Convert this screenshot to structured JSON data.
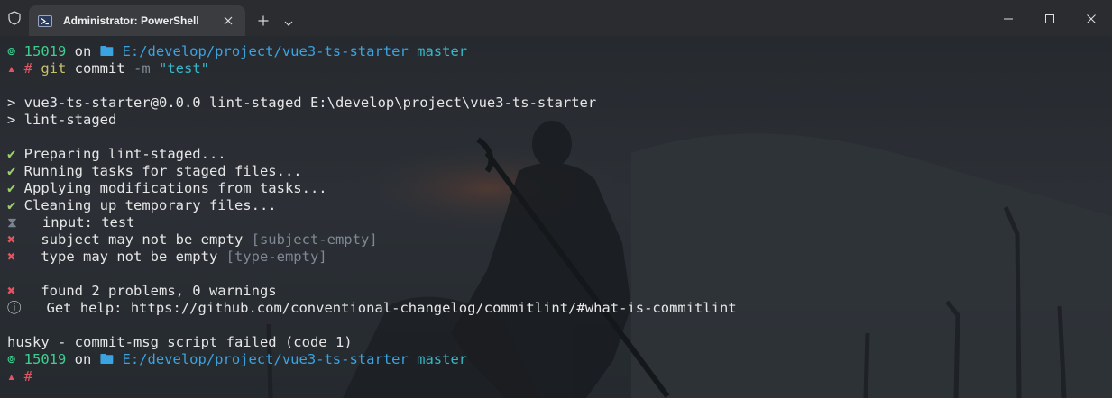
{
  "window": {
    "tab_title": "Administrator: PowerShell"
  },
  "icons": {
    "shield": "shield-icon",
    "terminal": "powershell-icon",
    "close": "close-icon",
    "new_tab": "plus-icon",
    "dropdown": "chevron-down-icon",
    "minimize": "minimize-icon",
    "maximize": "maximize-icon",
    "window_close": "close-icon"
  },
  "colors": {
    "prompt_green": "#3ecf8e",
    "path_blue": "#3ba3e0",
    "branch_cyan": "#37b8c9",
    "error_red": "#e05561",
    "check_green": "#9ecf6a"
  },
  "terminal": {
    "prompt1": {
      "symbol": "⊚ ",
      "pid": "15019",
      "on": " on ",
      "folder": "🖿 ",
      "path": "E:/develop/project/vue3-ts-starter",
      "branch_icon": " ",
      "branch": "master"
    },
    "command_line": {
      "arrow": "▴ ",
      "hash": "#",
      "git": " git",
      "commit": " commit",
      "flag": " -m",
      "arg": " \"test\""
    },
    "npm_line1": "> vue3-ts-starter@0.0.0 lint-staged E:\\develop\\project\\vue3-ts-starter",
    "npm_line2": "> lint-staged",
    "tasks": [
      {
        "icon": "✔",
        "text": " Preparing lint-staged..."
      },
      {
        "icon": "✔",
        "text": " Running tasks for staged files..."
      },
      {
        "icon": "✔",
        "text": " Applying modifications from tasks..."
      },
      {
        "icon": "✔",
        "text": " Cleaning up temporary files..."
      }
    ],
    "input_line": {
      "icon": "⧗",
      "text": "   input: test"
    },
    "errors": [
      {
        "icon": "✖",
        "text": "   subject may not be empty ",
        "rule": "[subject-empty]"
      },
      {
        "icon": "✖",
        "text": "   type may not be empty ",
        "rule": "[type-empty]"
      }
    ],
    "summary": {
      "icon": "✖",
      "text": "   found 2 problems, 0 warnings"
    },
    "help": {
      "icon": "ⓘ",
      "text": "   Get help: https://github.com/conventional-changelog/commitlint/#what-is-commitlint"
    },
    "husky": "husky - commit-msg script failed (code 1)",
    "prompt2": {
      "symbol": "⊚ ",
      "pid": "15019",
      "on": " on ",
      "folder": "🖿 ",
      "path": "E:/develop/project/vue3-ts-starter",
      "branch_icon": " ",
      "branch": "master"
    },
    "final_prompt": {
      "arrow": "▴ ",
      "hash": "#"
    }
  }
}
